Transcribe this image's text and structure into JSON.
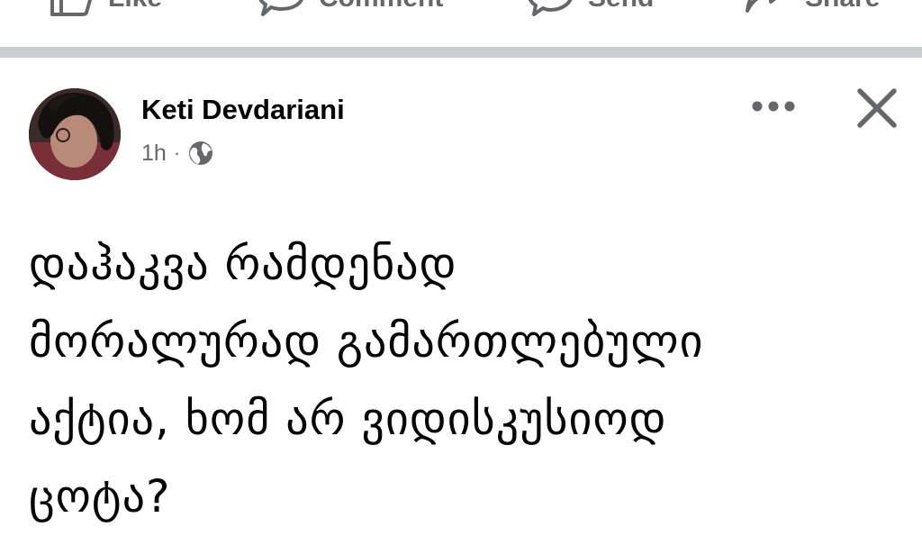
{
  "actions": {
    "like": {
      "label": "Like",
      "icon": "thumbs-up-icon"
    },
    "comment": {
      "label": "Comment",
      "icon": "comment-bubble-icon"
    },
    "send": {
      "label": "Send",
      "icon": "messenger-icon"
    },
    "share": {
      "label": "Share",
      "icon": "share-arrow-icon"
    }
  },
  "post": {
    "author": "Keti Devdariani",
    "time": "1h",
    "separator": "·",
    "audience_icon": "globe-icon",
    "text_lines": [
      "დაჰაკვა რამდენად",
      "მორალურად გამართლებული",
      "აქტია, ხომ არ ვიდისკუსიოდ",
      "ცოტა?"
    ]
  },
  "controls": {
    "more_icon": "more-options-icon",
    "close_icon": "close-icon"
  },
  "colors": {
    "text_primary": "#050505",
    "text_secondary": "#65676b",
    "divider": "#c9ccd1",
    "background": "#ffffff"
  }
}
